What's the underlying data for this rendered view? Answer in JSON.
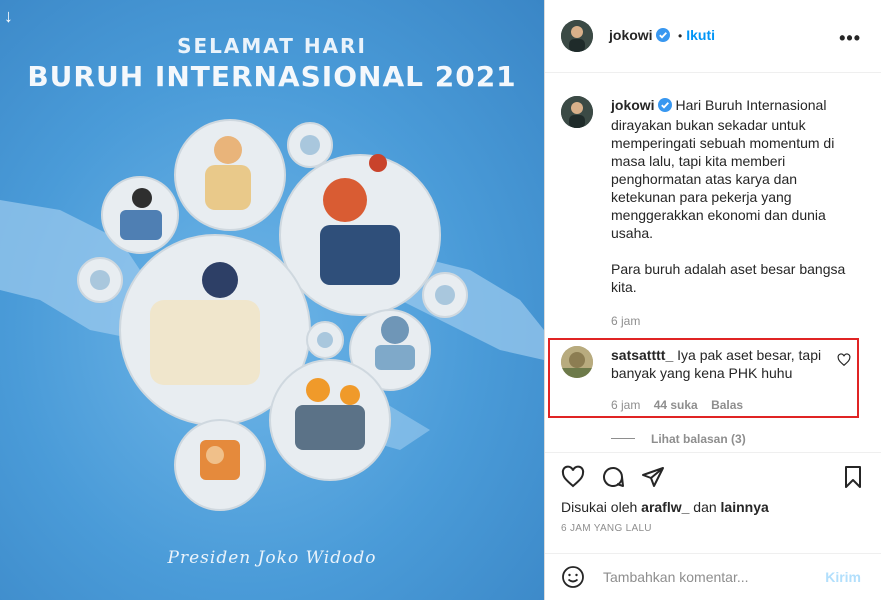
{
  "post": {
    "title_line1": "SELAMAT HARI",
    "title_line2": "BURUH INTERNASIONAL 2021",
    "signature": "Presiden Joko Widodo"
  },
  "header": {
    "username": "jokowi",
    "separator": "•",
    "follow_label": "Ikuti",
    "more_icon": "more-options-icon"
  },
  "caption": {
    "username": "jokowi",
    "text_p1": "Hari Buruh Internasional dirayakan bukan sekadar untuk memperingati sebuah momentum di masa lalu, tapi kita memberi penghormatan atas karya dan ketekunan para pekerja yang menggerakkan ekonomi dan dunia usaha.",
    "text_p2": "Para buruh adalah aset besar bangsa kita.",
    "time": "6 jam"
  },
  "comment": {
    "username": "satsatttt_",
    "text": "Iya pak aset besar, tapi banyak yang kena PHK huhu",
    "time": "6 jam",
    "likes": "44 suka",
    "reply": "Balas",
    "view_replies": "Lihat balasan (3)"
  },
  "likes": {
    "prefix": "Disukai oleh",
    "user": "araflw_",
    "and": "dan",
    "others": "lainnya"
  },
  "time_ago": "6 JAM YANG LALU",
  "add_comment": {
    "placeholder": "Tambahkan komentar...",
    "send_label": "Kirim"
  },
  "colors": {
    "link_blue": "#0095f6",
    "send_disabled": "#b2dffc",
    "highlight_red": "#e02424",
    "image_bg": "#4a9bd8"
  }
}
